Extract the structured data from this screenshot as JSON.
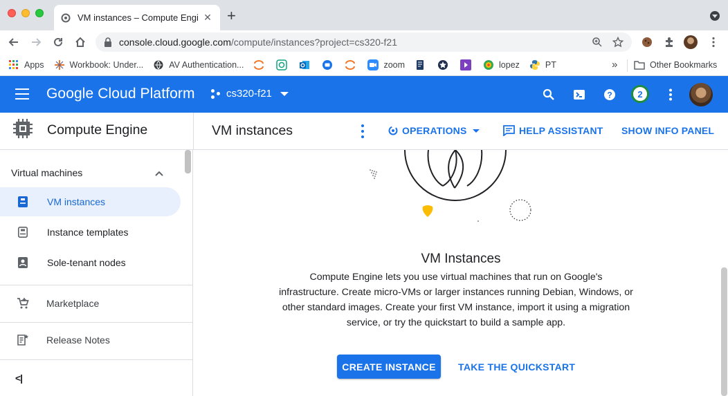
{
  "browser": {
    "tab_title": "VM instances – Compute Engin",
    "url_host": "console.cloud.google.com",
    "url_path": "/compute/instances?project=cs320-f21",
    "bookmarks": [
      {
        "label": "Apps",
        "icon": "apps-grid-icon"
      },
      {
        "label": "Workbook: Under...",
        "icon": "tableau-icon"
      },
      {
        "label": "AV Authentication...",
        "icon": "globe-icon"
      },
      {
        "label": "",
        "icon": "jupyter-icon"
      },
      {
        "label": "",
        "icon": "openai-icon"
      },
      {
        "label": "",
        "icon": "outlook-icon"
      },
      {
        "label": "",
        "icon": "chat-icon"
      },
      {
        "label": "",
        "icon": "jupyter-icon-2"
      },
      {
        "label": "zoom",
        "icon": "zoom-icon"
      },
      {
        "label": "",
        "icon": "bookmark-doc-icon"
      },
      {
        "label": "",
        "icon": "badge-icon"
      },
      {
        "label": "",
        "icon": "play-icon"
      },
      {
        "label": "lopez",
        "icon": "lopez-icon"
      },
      {
        "label": "PT",
        "icon": "python-icon"
      }
    ],
    "more_bookmarks": "»",
    "other_bookmarks": "Other Bookmarks"
  },
  "gcp": {
    "logo": "Google Cloud Platform",
    "project": "cs320-f21",
    "notification_count": "2"
  },
  "subheader": {
    "product": "Compute Engine",
    "page_title": "VM instances",
    "operations": "OPERATIONS",
    "help_assistant": "HELP ASSISTANT",
    "show_info_panel": "SHOW INFO PANEL"
  },
  "sidebar": {
    "section": "Virtual machines",
    "items": [
      {
        "label": "VM instances"
      },
      {
        "label": "Instance templates"
      },
      {
        "label": "Sole-tenant nodes"
      }
    ],
    "marketplace": "Marketplace",
    "release_notes": "Release Notes",
    "collapse": "<|"
  },
  "main": {
    "title": "VM Instances",
    "description": "Compute Engine lets you use virtual machines that run on Google's infrastructure. Create micro-VMs or larger instances running Debian, Windows, or other standard images. Create your first VM instance, import it using a migration service, or try the quickstart to build a sample app.",
    "create_button": "CREATE INSTANCE",
    "quickstart_button": "TAKE THE QUICKSTART"
  },
  "colors": {
    "brand_blue": "#1a73e8",
    "active_bg": "#e8f0fe",
    "notification_ring": "#1e8e3e",
    "illustration_yellow": "#fbbc04"
  }
}
